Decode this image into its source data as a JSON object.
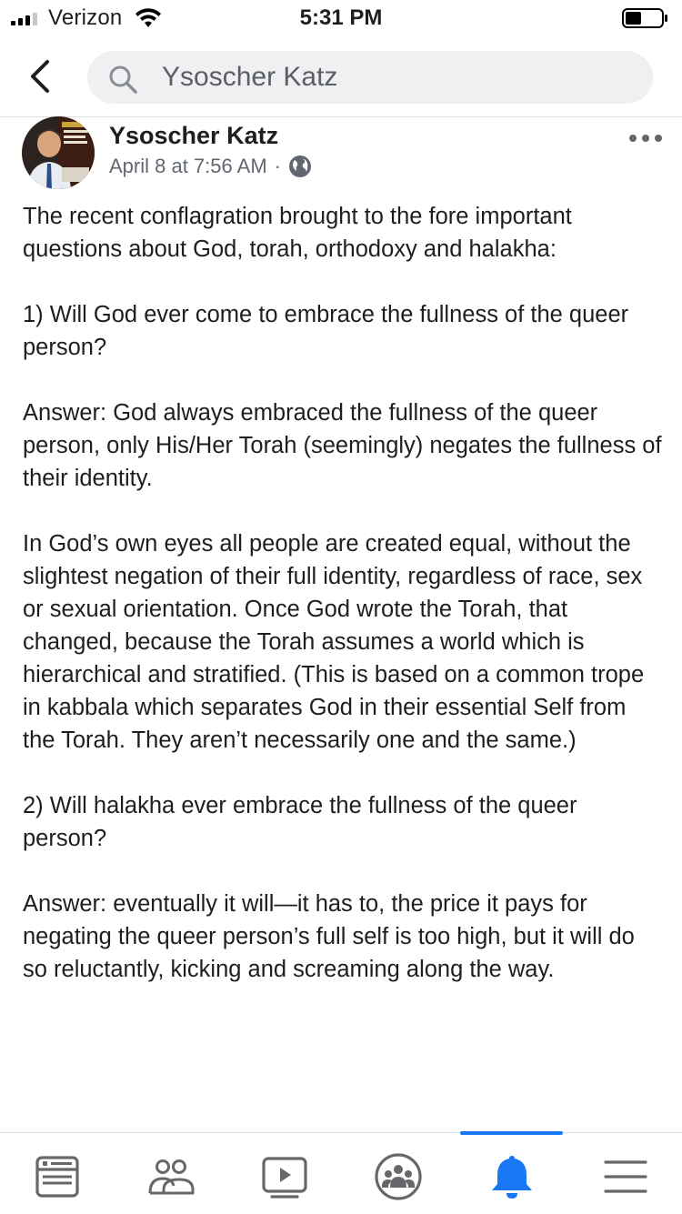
{
  "status_bar": {
    "carrier": "Verizon",
    "time": "5:31 PM",
    "battery_level": 0.45
  },
  "nav": {
    "back_icon": "chevron-left-icon",
    "search_icon": "search-icon",
    "search_value": "Ysoscher Katz"
  },
  "post": {
    "author": "Ysoscher Katz",
    "timestamp": "April 8 at 7:56 AM",
    "separator": "·",
    "privacy_icon": "globe-icon",
    "more_icon": "more-horizontal-icon",
    "paragraphs": [
      "The recent conflagration brought to the fore important questions about God, torah, orthodoxy and halakha:",
      "1) Will God ever come to embrace the fullness of the queer person?",
      "Answer: God always embraced the fullness of the queer person, only His/Her Torah (seemingly) negates the fullness of their identity.",
      "In God’s own eyes all people are created equal, without the slightest negation of their full identity, regardless of race, sex or sexual orientation. Once God wrote the Torah, that changed, because the Torah assumes a world which is hierarchical and stratified. (This is based on a common trope in kabbala which separates God in their essential Self from the Torah. They aren’t necessarily one and the same.)",
      "2) Will halakha ever embrace the fullness of the queer person?",
      "Answer: eventually it will—it has to, the price it pays for negating the queer person’s full self is too high, but it will do so reluctantly, kicking and screaming along the way."
    ]
  },
  "tab_bar": {
    "tabs": [
      {
        "icon": "news-feed-icon"
      },
      {
        "icon": "friends-icon"
      },
      {
        "icon": "watch-video-icon"
      },
      {
        "icon": "groups-icon"
      },
      {
        "icon": "notifications-bell-icon",
        "active": true
      },
      {
        "icon": "menu-icon"
      }
    ]
  },
  "colors": {
    "accent": "#1877f2",
    "icon_gray": "#65676b",
    "text": "#1c1e21",
    "secondary_text": "#616770",
    "search_bg": "#eff0f2"
  }
}
